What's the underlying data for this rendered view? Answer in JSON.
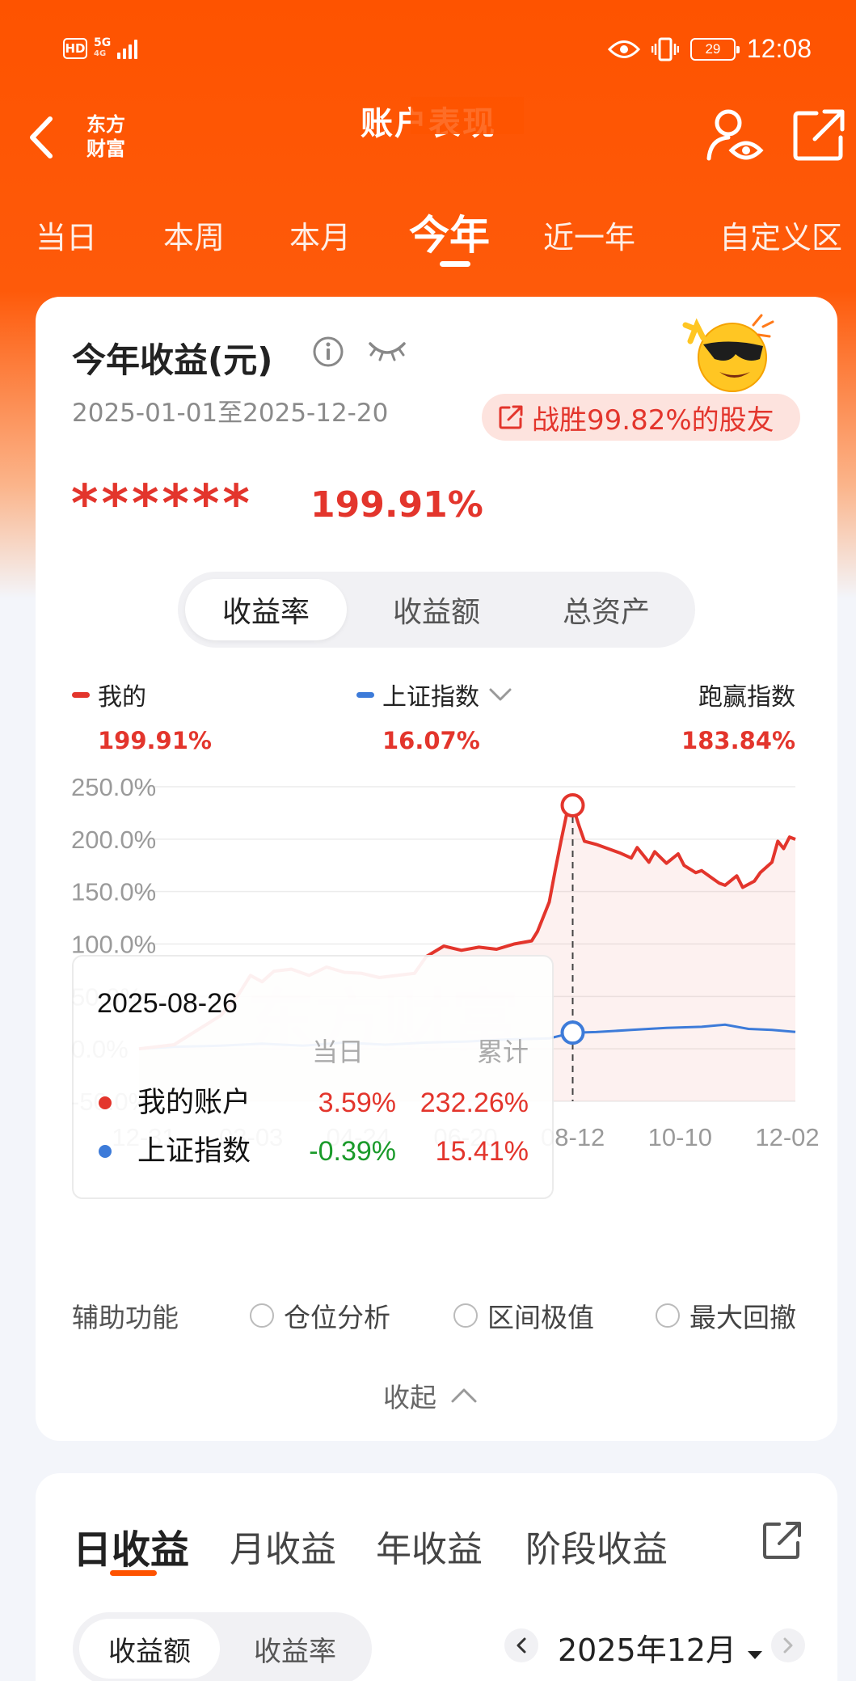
{
  "status_bar": {
    "network_left": "HD",
    "network_gen": "5G",
    "network_sub": "4G",
    "battery": "29",
    "time": "12:08"
  },
  "nav": {
    "logo_line1": "东方",
    "logo_line2": "财富",
    "title": "账户表现"
  },
  "period_tabs": [
    "当日",
    "本周",
    "本月",
    "今年",
    "近一年",
    "自定义区"
  ],
  "active_period": "今年",
  "summary": {
    "title": "今年收益(元)",
    "date_range": "2025-01-01至2025-12-20",
    "beat_text": "战胜99.82%的股友",
    "hidden_amount": "******",
    "return_pct": "199.91%"
  },
  "metric_tabs": [
    "收益率",
    "收益额",
    "总资产"
  ],
  "active_metric": "收益率",
  "legend": {
    "mine_label": "我的",
    "mine_value": "199.91%",
    "index_label": "上证指数",
    "index_value": "16.07%",
    "outperform_label": "跑赢指数",
    "outperform_value": "183.84%"
  },
  "colors": {
    "brand": "#fe5300",
    "rise": "#e3352c",
    "fall": "#1a9a2a",
    "index_line": "#3d7bd9"
  },
  "chart_data": {
    "type": "line",
    "y_ticks": [
      "250.0%",
      "200.0%",
      "150.0%",
      "100.0%",
      "50.0%",
      "0.0%",
      "-50.0%"
    ],
    "ylim": [
      -50,
      250
    ],
    "x_ticks": [
      "12-31",
      "03-03",
      "04-24",
      "06-20",
      "08-12",
      "10-10",
      "12-02"
    ],
    "series": [
      {
        "name": "我的",
        "points": [
          [
            0,
            0
          ],
          [
            6,
            4
          ],
          [
            10,
            18
          ],
          [
            14,
            32
          ],
          [
            17,
            52
          ],
          [
            19,
            70
          ],
          [
            21,
            64
          ],
          [
            23,
            74
          ],
          [
            26,
            76
          ],
          [
            29,
            70
          ],
          [
            32,
            78
          ],
          [
            35,
            73
          ],
          [
            38,
            72
          ],
          [
            41,
            68
          ],
          [
            44,
            70
          ],
          [
            47,
            72
          ],
          [
            49,
            88
          ],
          [
            52,
            98
          ],
          [
            55,
            94
          ],
          [
            58,
            97
          ],
          [
            61,
            95
          ],
          [
            64,
            100
          ],
          [
            67,
            103
          ],
          [
            68,
            112
          ],
          [
            70,
            140
          ],
          [
            71,
            170
          ],
          [
            72,
            198
          ],
          [
            73,
            225
          ],
          [
            74,
            232
          ],
          [
            75,
            214
          ],
          [
            76,
            198
          ],
          [
            78,
            195
          ],
          [
            80,
            191
          ],
          [
            82,
            187
          ],
          [
            84,
            182
          ],
          [
            85,
            192
          ],
          [
            87,
            178
          ],
          [
            88,
            188
          ],
          [
            90,
            177
          ],
          [
            92,
            186
          ],
          [
            93,
            175
          ],
          [
            95,
            168
          ],
          [
            96,
            170
          ],
          [
            98,
            162
          ],
          [
            99,
            158
          ],
          [
            100,
            156
          ],
          [
            102,
            165
          ],
          [
            103,
            154
          ],
          [
            105,
            160
          ],
          [
            106,
            168
          ],
          [
            108,
            178
          ],
          [
            109,
            198
          ],
          [
            110,
            191
          ],
          [
            111,
            202
          ],
          [
            112,
            199.91
          ]
        ]
      },
      {
        "name": "上证指数",
        "points": [
          [
            0,
            0
          ],
          [
            6,
            2
          ],
          [
            14,
            3
          ],
          [
            21,
            5
          ],
          [
            28,
            3
          ],
          [
            35,
            6
          ],
          [
            42,
            4
          ],
          [
            49,
            6
          ],
          [
            56,
            7
          ],
          [
            63,
            9
          ],
          [
            70,
            10
          ],
          [
            74,
            15.41
          ],
          [
            78,
            16
          ],
          [
            84,
            18
          ],
          [
            90,
            20
          ],
          [
            96,
            21
          ],
          [
            100,
            23
          ],
          [
            104,
            19
          ],
          [
            108,
            18
          ],
          [
            112,
            16.07
          ]
        ]
      }
    ],
    "highlight_index": 74,
    "grid": true,
    "watermark": "东方财富"
  },
  "tooltip": {
    "date": "2025-08-26",
    "col_day": "当日",
    "col_cum": "累计",
    "rows": [
      {
        "name": "我的账户",
        "day": "3.59%",
        "cum": "232.26%"
      },
      {
        "name": "上证指数",
        "day": "-0.39%",
        "cum": "15.41%"
      }
    ]
  },
  "aux": {
    "label": "辅助功能",
    "options": [
      "仓位分析",
      "区间极值",
      "最大回撤"
    ]
  },
  "collapse_label": "收起",
  "earnings": {
    "tabs": [
      "日收益",
      "月收益",
      "年收益",
      "阶段收益"
    ],
    "active": "日收益",
    "sub_tabs": [
      "收益额",
      "收益率"
    ],
    "active_sub": "收益额",
    "month": "2025年12月"
  }
}
